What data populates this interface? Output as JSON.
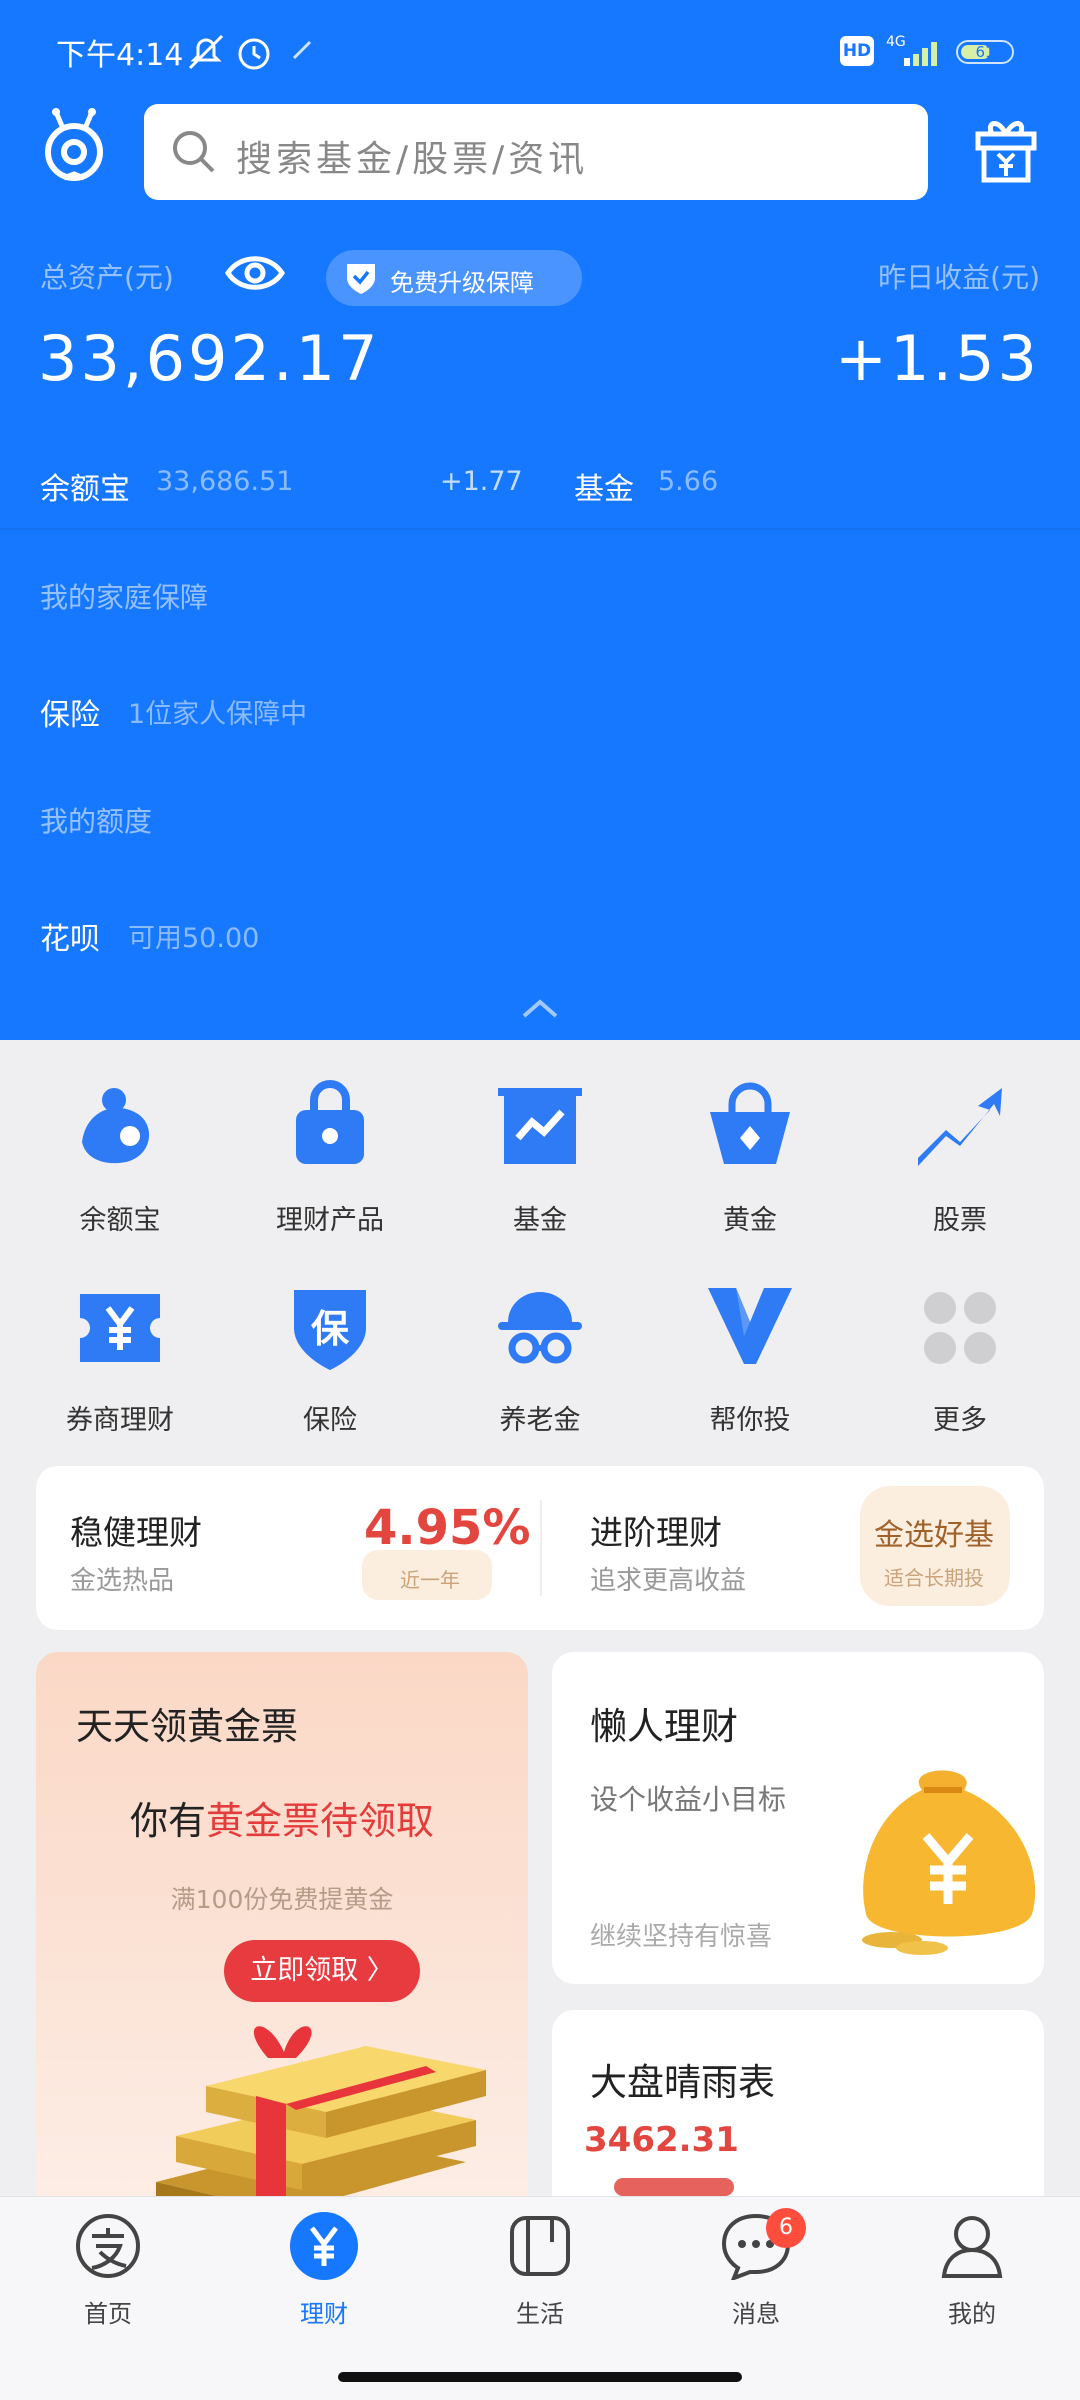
{
  "status_bar": {
    "time": "下午4:14",
    "hd_label": "HD",
    "network_label": "4G",
    "battery_level": "61"
  },
  "header": {
    "search_placeholder": "搜索基金/股票/资讯"
  },
  "assets": {
    "total_label": "总资产(元)",
    "total_value": "33,692.17",
    "upgrade_label": "免费升级保障",
    "yesterday_label": "昨日收益(元)",
    "yesterday_value": "+1.53",
    "yuebao_label": "余额宝",
    "yuebao_value": "33,686.51",
    "yuebao_gain": "+1.77",
    "fund_label": "基金",
    "fund_value": "5.66"
  },
  "protection": {
    "section_title": "我的家庭保障",
    "insurance_label": "保险",
    "insurance_value": "1位家人保障中",
    "credit_title": "我的额度",
    "huabei_label": "花呗",
    "huabei_value": "可用50.00"
  },
  "grid": {
    "items": [
      {
        "label": "余额宝",
        "icon": "yuebao-icon"
      },
      {
        "label": "理财产品",
        "icon": "lock-bag-icon"
      },
      {
        "label": "基金",
        "icon": "chart-board-icon"
      },
      {
        "label": "黄金",
        "icon": "gold-bag-icon"
      },
      {
        "label": "股票",
        "icon": "trend-up-icon"
      },
      {
        "label": "券商理财",
        "icon": "yen-ticket-icon"
      },
      {
        "label": "保险",
        "icon": "shield-icon"
      },
      {
        "label": "养老金",
        "icon": "hat-glasses-icon"
      },
      {
        "label": "帮你投",
        "icon": "v-logo-icon"
      },
      {
        "label": "更多",
        "icon": "more-dots-icon"
      }
    ]
  },
  "finance": {
    "left_title": "稳健理财",
    "left_sub": "金选热品",
    "left_rate": "4.95%",
    "left_rate_tag": "近一年",
    "right_title": "进阶理财",
    "right_sub": "追求更高收益",
    "right_badge": "金选好基",
    "right_badge_tag": "适合长期投"
  },
  "promo": {
    "title": "天天领黄金票",
    "head_prefix": "你有",
    "head_highlight": "黄金票待领取",
    "sub": "满100份免费提黄金",
    "button": "立即领取 〉"
  },
  "lazy": {
    "title": "懒人理财",
    "sub": "设个收益小目标",
    "footer": "继续坚持有惊喜"
  },
  "weather": {
    "title": "大盘晴雨表",
    "value": "3462.31",
    "value_color": "#e2463f"
  },
  "tabbar": {
    "items": [
      {
        "label": "首页",
        "icon": "alipay-icon"
      },
      {
        "label": "理财",
        "icon": "yen-circle-icon"
      },
      {
        "label": "生活",
        "icon": "life-icon"
      },
      {
        "label": "消息",
        "icon": "chat-icon"
      },
      {
        "label": "我的",
        "icon": "person-icon"
      }
    ],
    "message_badge": "6",
    "active_color": "#1677ff"
  },
  "colors": {
    "brand_blue": "#1677ff",
    "accent_red": "#e43b3b"
  }
}
